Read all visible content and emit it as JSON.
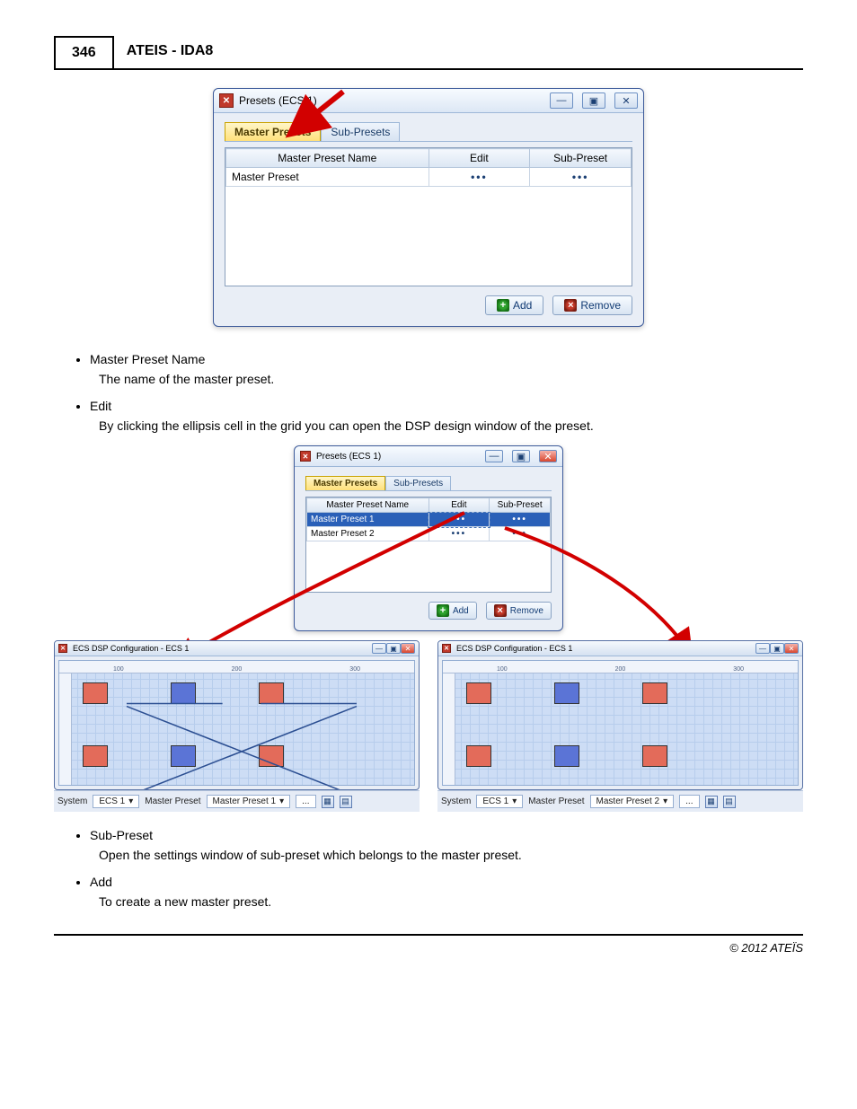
{
  "page": {
    "number": "346",
    "title": "ATEIS - IDA8",
    "copyright": "© 2012 ATEÏS"
  },
  "win1": {
    "title": "Presets (ECS 1)",
    "tabs": {
      "active": "Master Presets",
      "inactive": "Sub-Presets"
    },
    "cols": {
      "name": "Master Preset Name",
      "edit": "Edit",
      "sub": "Sub-Preset"
    },
    "rows": [
      {
        "name": "Master Preset",
        "edit": "•••",
        "sub": "•••"
      }
    ],
    "buttons": {
      "add": "Add",
      "remove": "Remove"
    }
  },
  "win2": {
    "title": "Presets (ECS 1)",
    "tabs": {
      "active": "Master Presets",
      "inactive": "Sub-Presets"
    },
    "cols": {
      "name": "Master Preset Name",
      "edit": "Edit",
      "sub": "Sub-Preset"
    },
    "rows": [
      {
        "name": "Master Preset 1",
        "edit": "•••",
        "sub": "•••"
      },
      {
        "name": "Master Preset 2",
        "edit": "•••",
        "sub": "•••"
      }
    ],
    "buttons": {
      "add": "Add",
      "remove": "Remove"
    }
  },
  "dsp_left": {
    "title": "ECS DSP Configuration - ECS 1",
    "system_label": "System",
    "system_value": "ECS 1",
    "mp_label": "Master Preset",
    "mp_value": "Master Preset 1",
    "ruler": [
      "100",
      "200",
      "300"
    ]
  },
  "dsp_right": {
    "title": "ECS DSP Configuration - ECS 1",
    "system_label": "System",
    "system_value": "ECS 1",
    "mp_label": "Master Preset",
    "mp_value": "Master Preset 2",
    "ruler": [
      "100",
      "200",
      "300"
    ]
  },
  "text": {
    "b1": "Master Preset Name",
    "d1": "The name of the master preset.",
    "b2": "Edit",
    "d2": "By clicking the ellipsis cell in the grid you can open the DSP design window of the preset.",
    "b3": "Sub-Preset",
    "d3": "Open the settings window of sub-preset which belongs to the master preset.",
    "b4": "Add",
    "d4": "To create a new master preset."
  }
}
